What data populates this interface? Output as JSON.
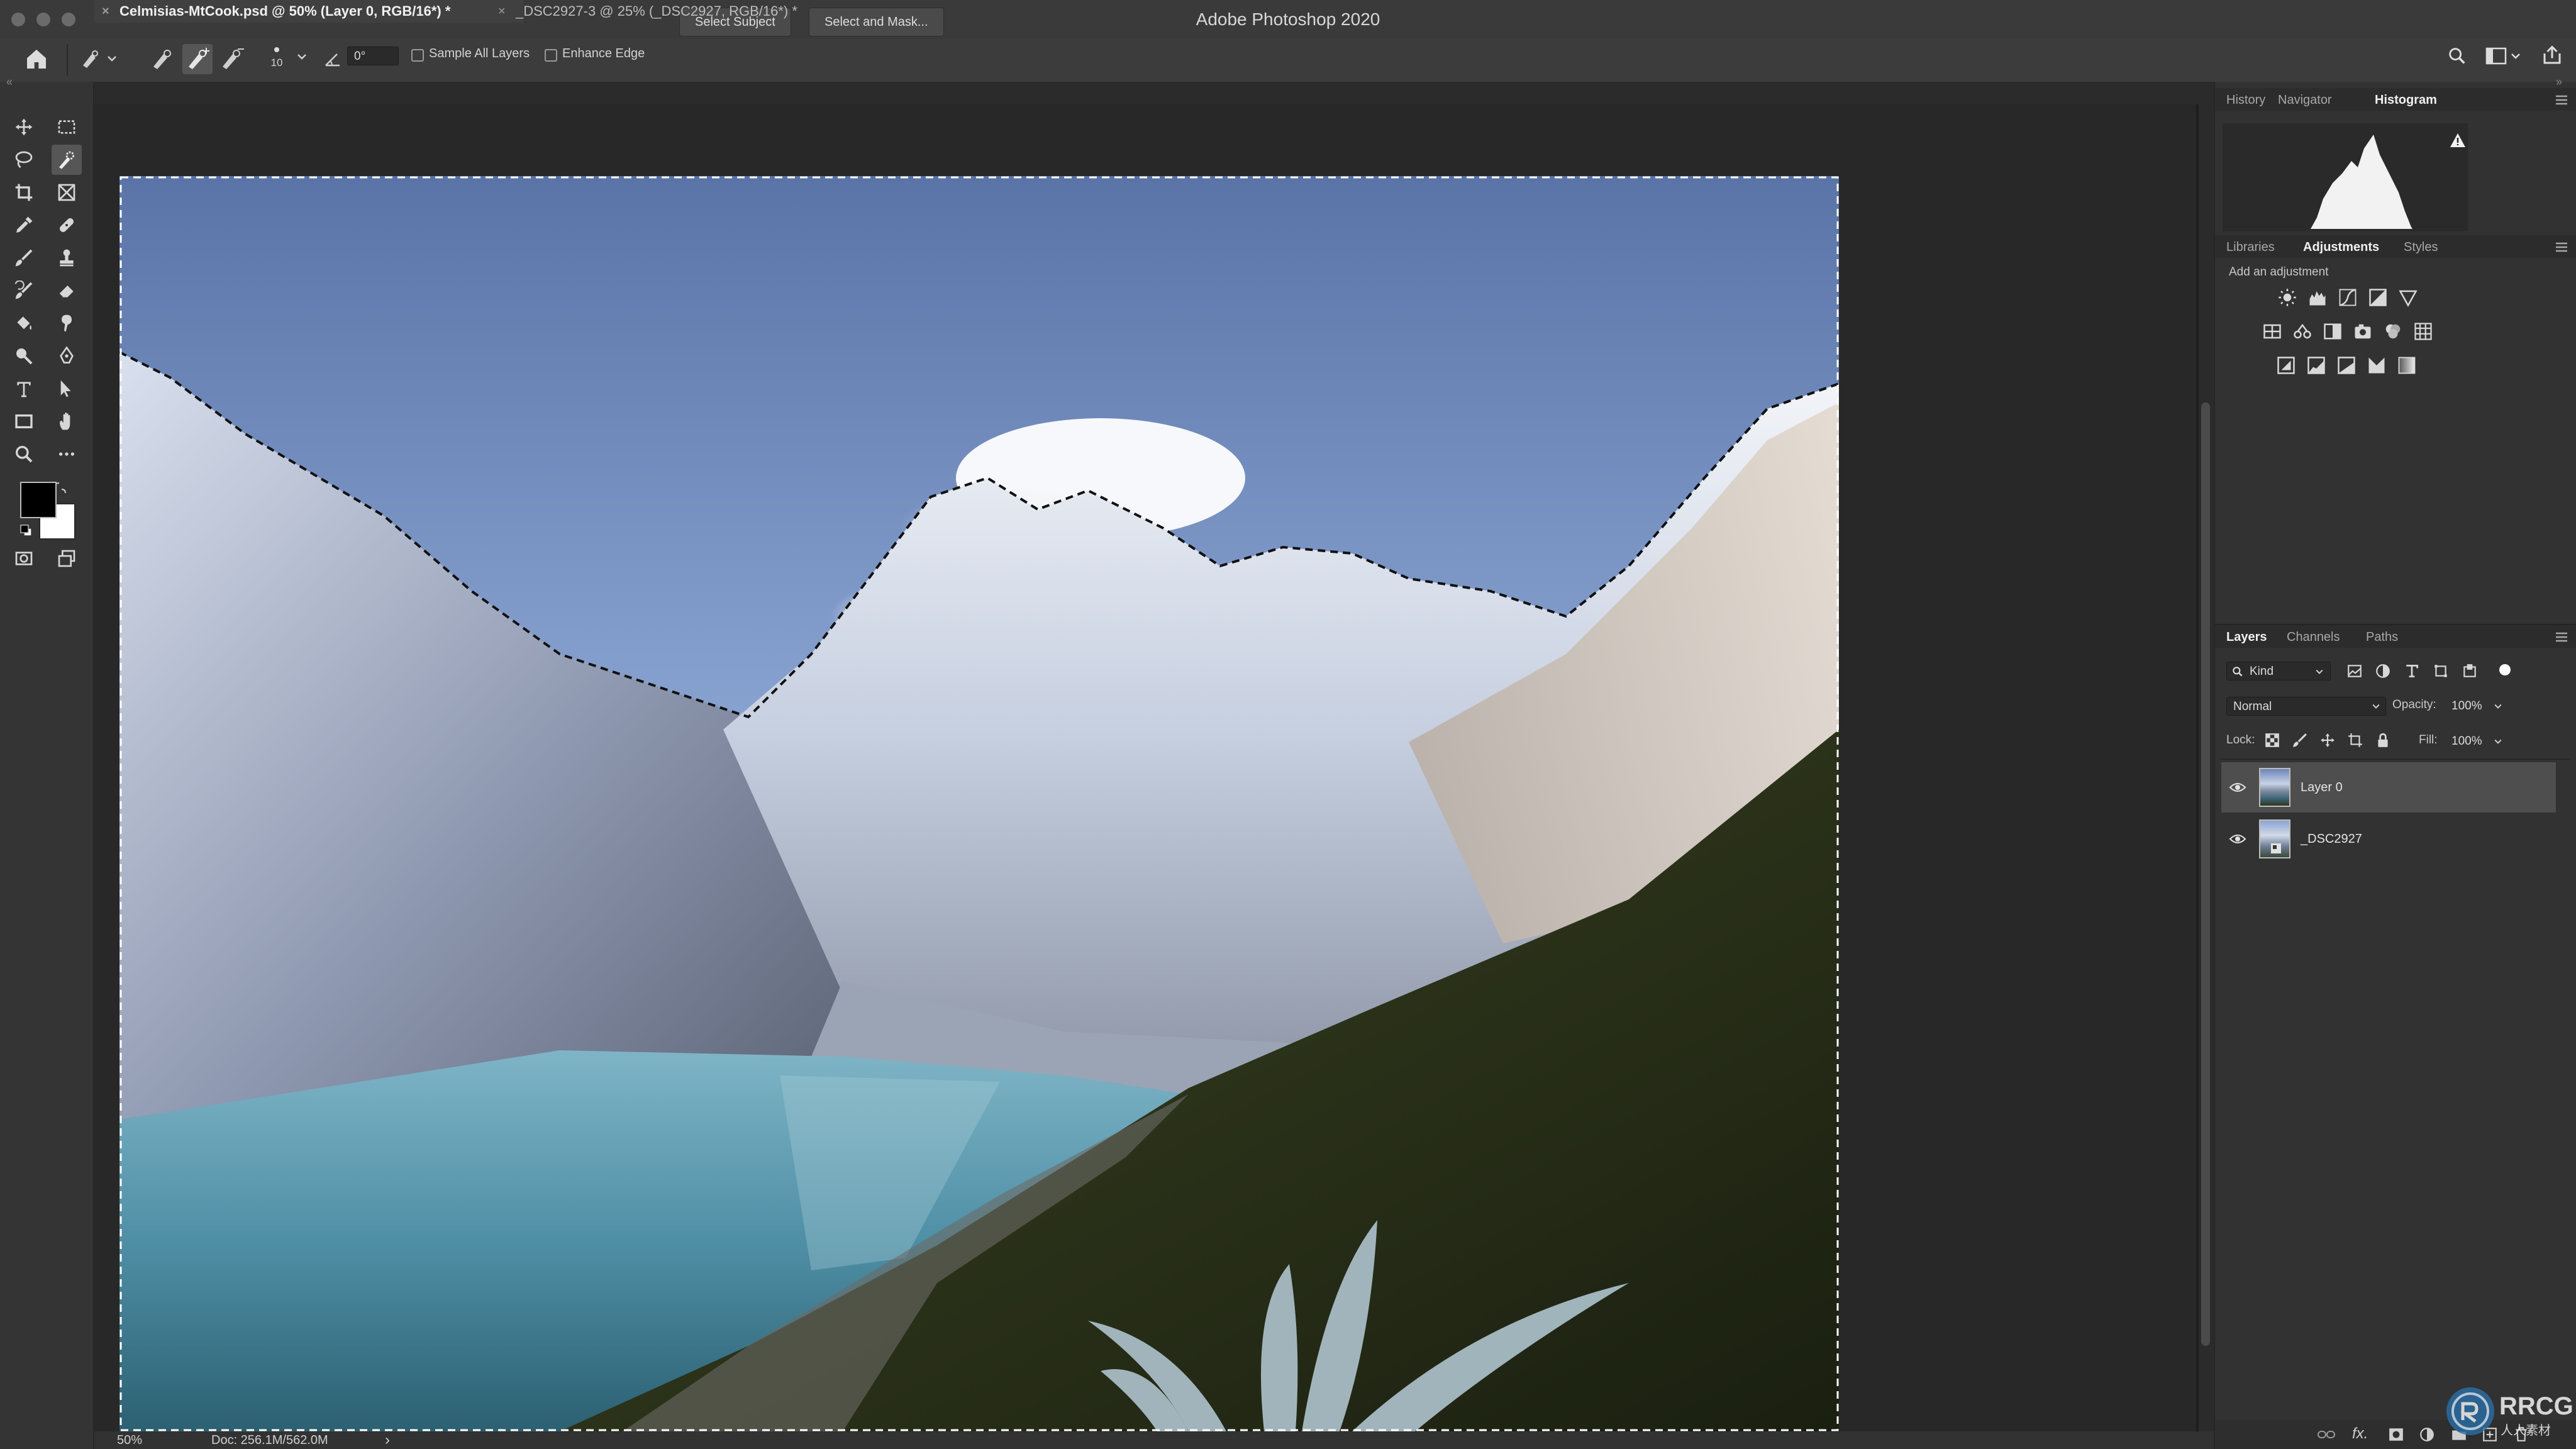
{
  "app": {
    "title": "Adobe Photoshop 2020"
  },
  "options_bar": {
    "brush_size": "10",
    "angle": "0°",
    "sample_all_layers": "Sample All Layers",
    "enhance_edge": "Enhance Edge",
    "select_subject": "Select Subject",
    "select_and_mask": "Select and Mask..."
  },
  "documents": {
    "tabs": [
      {
        "label": "Celmisias-MtCook.psd @ 50% (Layer 0, RGB/16*) *",
        "active": true
      },
      {
        "label": "_DSC2927-3 @ 25% (_DSC2927, RGB/16*) *",
        "active": false
      }
    ]
  },
  "status": {
    "zoom": "50%",
    "doc": "Doc: 256.1M/562.0M",
    "arrow": "›"
  },
  "panels": {
    "top_tabs": [
      "History",
      "Navigator",
      "Histogram"
    ],
    "mid_tabs": [
      "Libraries",
      "Adjustments",
      "Styles"
    ],
    "add_adjustment": "Add an adjustment",
    "layers_tabs": [
      "Layers",
      "Channels",
      "Paths"
    ],
    "kind_filter": "Kind",
    "blend_mode": "Normal",
    "opacity_label": "Opacity:",
    "opacity_value": "100%",
    "lock_label": "Lock:",
    "fill_label": "Fill:",
    "fill_value": "100%",
    "layers": [
      {
        "name": "Layer 0",
        "visible": true,
        "selected": true
      },
      {
        "name": "_DSC2927",
        "visible": true,
        "selected": false
      }
    ]
  },
  "watermark": {
    "brand": "RRCG",
    "sub": "人人素材"
  },
  "colors": {
    "accent_selection": "#ffffff",
    "panel": "#323232",
    "active_layer": "#4e4e4e"
  }
}
